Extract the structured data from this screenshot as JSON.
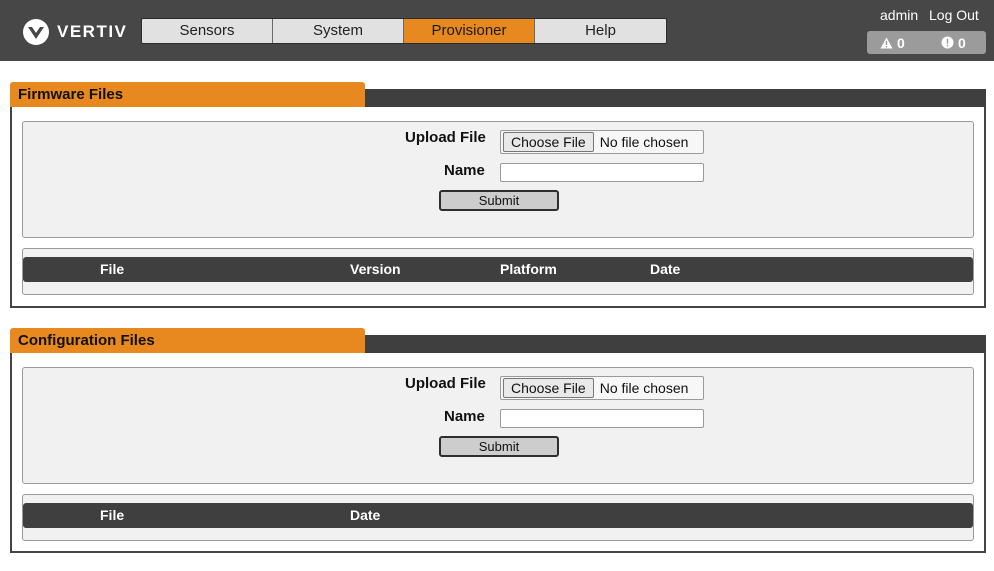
{
  "brand": {
    "name": "VERTIV",
    "accent_color": "#e8891f",
    "logo_icon": "vertiv-chevron-logo"
  },
  "nav": {
    "tabs": [
      {
        "label": "Sensors",
        "active": false
      },
      {
        "label": "System",
        "active": false
      },
      {
        "label": "Provisioner",
        "active": true
      },
      {
        "label": "Help",
        "active": false
      }
    ]
  },
  "header": {
    "user": "admin",
    "logout_label": "Log Out",
    "warning_count": "0",
    "warning_icon": "warning-triangle-icon",
    "critical_count": "0",
    "critical_icon": "exclamation-circle-icon"
  },
  "firmware": {
    "title": "Firmware Files",
    "upload_label": "Upload File",
    "choose_file_label": "Choose File",
    "file_status": "No file chosen",
    "name_label": "Name",
    "name_value": "",
    "submit_label": "Submit",
    "columns": [
      "File",
      "Version",
      "Platform",
      "Date"
    ],
    "rows": []
  },
  "configuration": {
    "title": "Configuration Files",
    "upload_label": "Upload File",
    "choose_file_label": "Choose File",
    "file_status": "No file chosen",
    "name_label": "Name",
    "name_value": "",
    "submit_label": "Submit",
    "columns": [
      "File",
      "Date"
    ],
    "rows": []
  }
}
